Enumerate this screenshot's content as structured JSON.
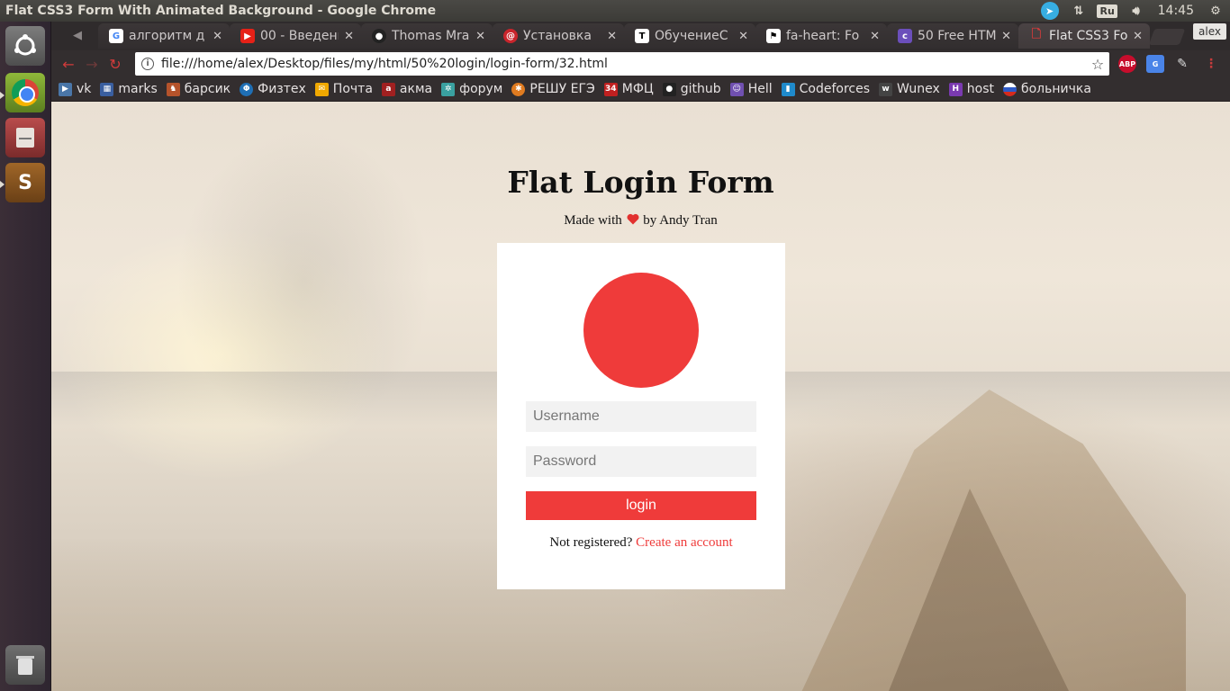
{
  "os": {
    "window_title": "Flat CSS3 Form With Animated Background - Google Chrome",
    "language": "Ru",
    "clock": "14:45"
  },
  "browser": {
    "tabs": [
      {
        "title": "алгоритм д",
        "favicon": "google-icon",
        "color": "#ffffff"
      },
      {
        "title": "00 - Введени",
        "favicon": "youtube-icon",
        "color": "#e62117"
      },
      {
        "title": "Thomas Mra",
        "favicon": "github-icon",
        "color": "#222222"
      },
      {
        "title": "Установка",
        "favicon": "debian-icon",
        "color": "#c9252c"
      },
      {
        "title": "ОбучениеС",
        "favicon": "t-icon",
        "color": "#ffffff"
      },
      {
        "title": "fa-heart: Fo",
        "favicon": "flag-icon",
        "color": "#ffffff"
      },
      {
        "title": "50 Free HTM",
        "favicon": "colorlib-icon",
        "color": "#6b4fbb"
      },
      {
        "title": "Flat CSS3 Fo",
        "favicon": "file-icon",
        "color": "#d23b3b"
      }
    ],
    "profile": "alex",
    "url": "file:///home/alex/Desktop/files/my/html/50%20login/login-form/32.html",
    "bookmarks": [
      {
        "label": "vk",
        "icon": "vk-icon",
        "color": "#4a76a8"
      },
      {
        "label": "marks",
        "icon": "marks-icon",
        "color": "#3a5fa0"
      },
      {
        "label": "барсик",
        "icon": "barsik-icon",
        "color": "#b5532b"
      },
      {
        "label": "Физтех",
        "icon": "phystech-icon",
        "color": "#1f6fb5"
      },
      {
        "label": "Почта",
        "icon": "mail-icon",
        "color": "#f0a800"
      },
      {
        "label": "акма",
        "icon": "akma-icon",
        "color": "#a02020"
      },
      {
        "label": "форум",
        "icon": "forum-icon",
        "color": "#3aa0a0"
      },
      {
        "label": "РЕШУ ЕГЭ",
        "icon": "reshu-icon",
        "color": "#e07b20"
      },
      {
        "label": "МФЦ",
        "icon": "mfc-icon",
        "color": "#c02020"
      },
      {
        "label": "github",
        "icon": "github-icon",
        "color": "#222222"
      },
      {
        "label": "Hell",
        "icon": "hell-icon",
        "color": "#7050b0"
      },
      {
        "label": "Codeforces",
        "icon": "codeforces-icon",
        "color": "#1f8acb"
      },
      {
        "label": "Wunex",
        "icon": "wunex-icon",
        "color": "#444444"
      },
      {
        "label": "host",
        "icon": "host-icon",
        "color": "#7a3ab0"
      },
      {
        "label": "больничка",
        "icon": "flag-ru-icon",
        "color": "#d52b1e"
      }
    ]
  },
  "page": {
    "title": "Flat Login Form",
    "subtitle_prefix": "Made with",
    "subtitle_suffix": "by Andy Tran",
    "username_placeholder": "Username",
    "password_placeholder": "Password",
    "login_label": "login",
    "not_registered": "Not registered?",
    "create_account": "Create an account",
    "accent_color": "#ef3b3a"
  }
}
